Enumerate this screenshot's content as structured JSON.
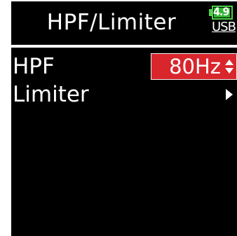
{
  "screen": {
    "title": "HPF/Limiter",
    "battery": {
      "value": "4.9",
      "level": 0.9,
      "power_source": "USB",
      "color": "#4cd24c"
    }
  },
  "menu": {
    "items": [
      {
        "label": "HPF",
        "value": "80Hz",
        "control": "updown-selector",
        "selected": true,
        "highlight_color": "#d9262d"
      },
      {
        "label": "Limiter",
        "control": "submenu-arrow",
        "selected": false
      }
    ]
  }
}
